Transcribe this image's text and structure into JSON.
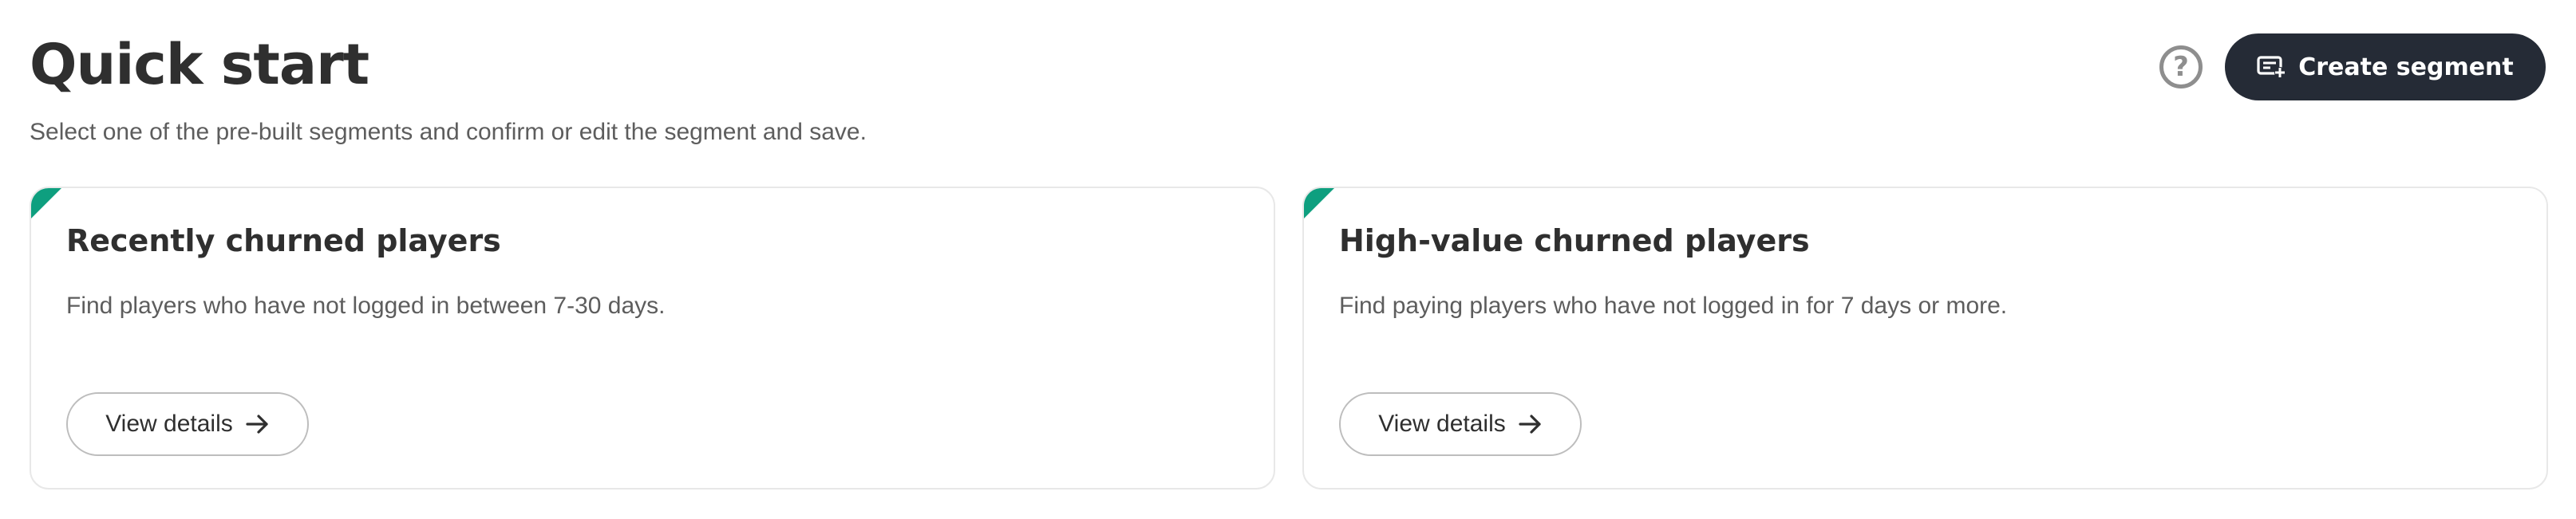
{
  "header": {
    "title": "Quick start",
    "subtitle": "Select one of the pre-built segments and confirm or edit the segment and save.",
    "help_icon": "help-circle-icon",
    "help_glyph": "?",
    "create_label": "Create segment",
    "create_icon": "add-segment-icon"
  },
  "cards": [
    {
      "title": "Recently churned players",
      "description": "Find players who have not logged in between 7-30 days.",
      "button_label": "View details",
      "button_icon": "arrow-right-icon"
    },
    {
      "title": "High-value churned players",
      "description": "Find paying players who have not logged in for 7 days or more.",
      "button_label": "View details",
      "button_icon": "arrow-right-icon"
    }
  ],
  "colors": {
    "accent": "#0e9f7f",
    "primary_button": "#252b36",
    "text": "#2f2f2f",
    "muted_text": "#5d5d5d",
    "border": "#e8e8e8"
  }
}
